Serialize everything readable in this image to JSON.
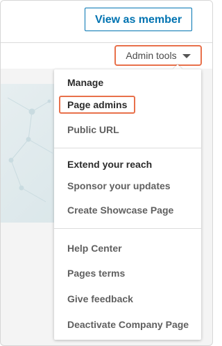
{
  "header": {
    "view_as_member_label": "View as member"
  },
  "admin_tools": {
    "label": "Admin tools"
  },
  "menu": {
    "sections": [
      {
        "heading": "Manage",
        "items": [
          "Page admins",
          "Public URL"
        ]
      },
      {
        "heading": "Extend your reach",
        "items": [
          "Sponsor your updates",
          "Create Showcase Page"
        ]
      },
      {
        "heading": "",
        "items": [
          "Help Center",
          "Pages terms",
          "Give feedback",
          "Deactivate Company Page"
        ]
      }
    ]
  },
  "colors": {
    "accent_blue": "#0073b1",
    "highlight_orange": "#e8704a"
  },
  "icons": {
    "admin_tools_caret": "caret-down-icon"
  }
}
